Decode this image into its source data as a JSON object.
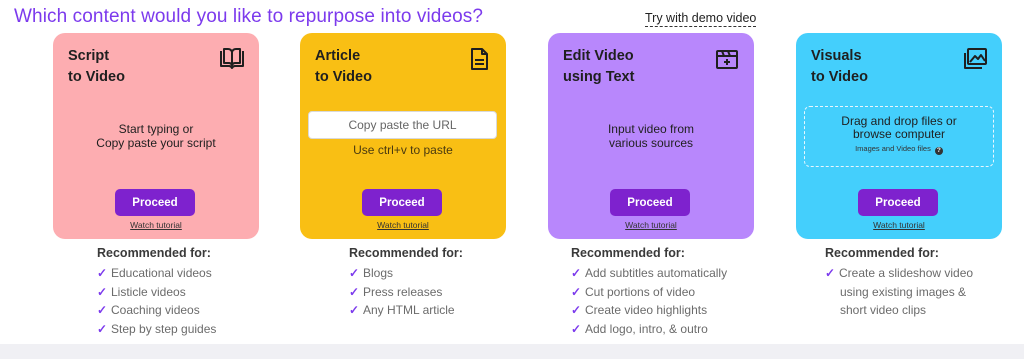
{
  "header": {
    "title": "Which content would you like to repurpose into videos?",
    "demo_link": "Try with demo video"
  },
  "colors": {
    "script": "#fdadb1",
    "article": "#f9bf14",
    "edit": "#b887fc",
    "visuals": "#44cffc",
    "button": "#7e22ce",
    "check": "#7c3aed",
    "title": "#7c3aed"
  },
  "cards": {
    "script": {
      "title_l1": "Script",
      "title_l2": "to Video",
      "icon": "open-book-icon",
      "body_l1": "Start typing or",
      "body_l2": "Copy paste your script",
      "button": "Proceed",
      "tutorial": "Watch tutorial"
    },
    "article": {
      "title_l1": "Article",
      "title_l2": "to Video",
      "icon": "document-icon",
      "input_placeholder": "Copy paste the URL",
      "hint": "Use ctrl+v to paste",
      "button": "Proceed",
      "tutorial": "Watch tutorial"
    },
    "edit": {
      "title_l1": "Edit Video",
      "title_l2": "using Text",
      "icon": "video-edit-icon",
      "body_l1": "Input video from",
      "body_l2": "various sources",
      "button": "Proceed",
      "tutorial": "Watch tutorial"
    },
    "visuals": {
      "title_l1": "Visuals",
      "title_l2": "to Video",
      "icon": "images-icon",
      "drop_l1": "Drag and drop files or",
      "drop_l2": "browse computer",
      "drop_sub": "Images and Video files",
      "button": "Proceed",
      "tutorial": "Watch tutorial"
    }
  },
  "recommended": {
    "label": "Recommended for:",
    "script": [
      "Educational videos",
      "Listicle videos",
      "Coaching videos",
      "Step by step guides"
    ],
    "article": [
      "Blogs",
      "Press releases",
      "Any HTML article"
    ],
    "edit": [
      "Add subtitles automatically",
      "Cut portions of video",
      "Create video highlights",
      "Add logo, intro, & outro"
    ],
    "visuals_l1": "Create a slideshow video",
    "visuals_l2": "using existing images &",
    "visuals_l3": "short video clips"
  }
}
